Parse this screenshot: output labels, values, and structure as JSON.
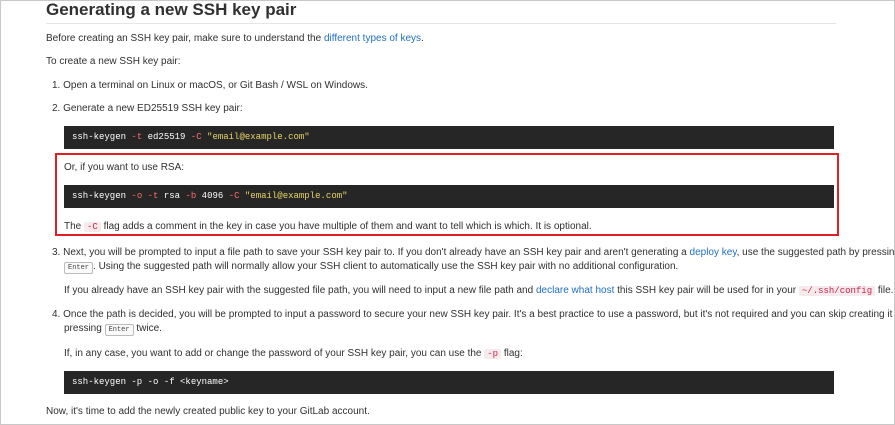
{
  "heading": "Generating a new SSH key pair",
  "intro": {
    "before": "Before creating an SSH key pair, make sure to understand the ",
    "link": "different types of keys",
    "after": "."
  },
  "to_create": "To create a new SSH key pair:",
  "steps": {
    "one": "1. Open a terminal on Linux or macOS, or Git Bash / WSL on Windows.",
    "two": "2. Generate a new ED25519 SSH key pair:",
    "three": {
      "a": "3. Next, you will be prompted to input a file path to save your SSH key pair to. If you don't already have an SSH key pair and aren't generating a ",
      "link": "deploy key",
      "b": ", use the suggested path by pressing",
      "kbd": "Enter",
      "c": ". Using the suggested path will normally allow your SSH client to automatically use the SSH key pair with no additional configuration."
    },
    "three_extra": {
      "a": "If you already have an SSH key pair with the suggested file path, you will need to input a new file path and ",
      "link": "declare what host",
      "b": " this SSH key pair will be used for in your ",
      "code": "~/.ssh/config",
      "c": " file."
    },
    "four": {
      "a": "4. Once the path is decided, you will be prompted to input a password to secure your new SSH key pair. It's a best practice to use a password, but it's not required and you can skip creating it by",
      "b": "pressing ",
      "kbd": "Enter",
      "c": " twice."
    },
    "four_extra": {
      "a": "If, in any case, you want to add or change the password of your SSH key pair, you can use the ",
      "code": "-p",
      "b": " flag:"
    }
  },
  "code1": {
    "cmd": "ssh-keygen ",
    "f1": "-t",
    "v1": " ed25519 ",
    "f2": "-C",
    "s": " \"email@example.com\""
  },
  "rsa_intro": "Or, if you want to use RSA:",
  "code2": {
    "cmd": "ssh-keygen ",
    "f1": "-o",
    "sp": " ",
    "f2": "-t",
    "v1": " rsa ",
    "f3": "-b",
    "v2": " 4096 ",
    "f4": "-C",
    "s": " \"email@example.com\""
  },
  "c_note": {
    "a": "The ",
    "code": "-C",
    "b": " flag adds a comment in the key in case you have multiple of them and want to tell which is which. It is optional."
  },
  "code3": "ssh-keygen -p -o -f <keyname>",
  "outro": "Now, it's time to add the newly created public key to your GitLab account."
}
